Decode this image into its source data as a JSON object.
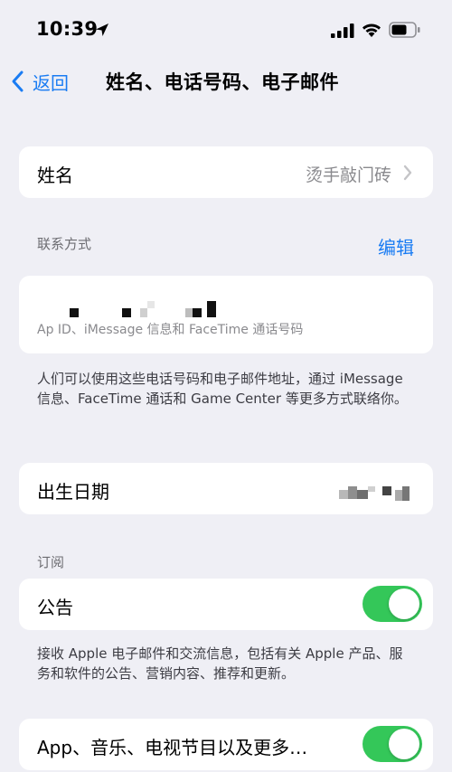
{
  "status_bar": {
    "time": "10:39"
  },
  "nav": {
    "back_label": "返回",
    "title": "姓名、电话号码、电子邮件"
  },
  "name_row": {
    "label": "姓名",
    "value": "烫手敲门砖"
  },
  "contact_section": {
    "header": "联系方式",
    "edit_label": "编辑",
    "subtitle": "Ap ID、iMessage 信息和 FaceTime 通话号码",
    "footnote": "人们可以使用这些电话号码和电子邮件地址，通过 iMessage 信息、FaceTime 通话和 Game Center 等更多方式联络你。"
  },
  "birthday_row": {
    "label": "出生日期"
  },
  "subscription_section": {
    "header": "订阅",
    "announcements_label": "公告",
    "announcements_enabled": true,
    "announcements_footnote": "接收 Apple 电子邮件和交流信息，包括有关 Apple 产品、服务和软件的公告、营销内容、推荐和更新。",
    "apps_label": "App、音乐、电视节目以及更多…",
    "apps_enabled": true
  },
  "colors": {
    "accent": "#1a7cf3",
    "toggle_on": "#34c759",
    "background": "#efeff5"
  },
  "icons": [
    "location-arrow-icon",
    "cellular-signal-icon",
    "wifi-icon",
    "battery-icon",
    "chevron-left-icon",
    "chevron-right-icon"
  ]
}
